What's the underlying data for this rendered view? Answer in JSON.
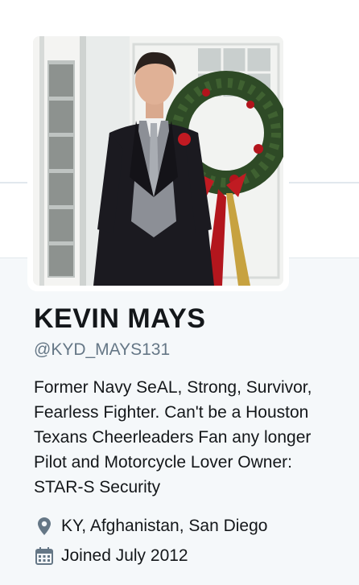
{
  "profile": {
    "name": "KEVIN MAYS",
    "handle": "@KYD_MAYS131",
    "bio": "Former Navy SeAL, Strong, Survivor,\nFearless Fighter. Can't be a Houston\nTexans Cheerleaders Fan any longer\nPilot and Motorcycle Lover Owner:\nSTAR-S Security",
    "location": "KY, Afghanistan, San Diego",
    "joined": "Joined July 2012"
  },
  "icons": {
    "location": "location-pin-icon",
    "joined": "calendar-icon"
  },
  "colors": {
    "background": "#f5f8fa",
    "text_primary": "#14171a",
    "text_secondary": "#657786",
    "icon": "#657786"
  }
}
